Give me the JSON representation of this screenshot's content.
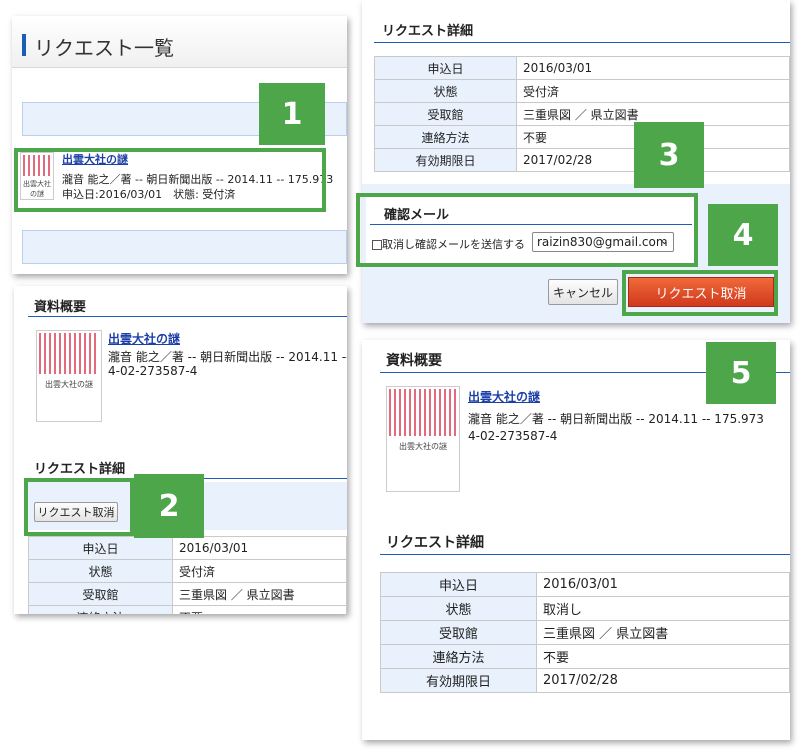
{
  "badges": [
    "1",
    "2",
    "3",
    "4",
    "5"
  ],
  "panel1": {
    "title": "リクエスト一覧",
    "item": {
      "book_title": "出雲大社の謎",
      "info": "瀧音 能之／著 -- 朝日新聞出版 -- 2014.11 -- 175.973",
      "status_line": "申込日:2016/03/01　状態: 受付済"
    },
    "thumb_title": "出雲大社の謎"
  },
  "panel2": {
    "overview_title": "資料概要",
    "book_title": "出雲大社の謎",
    "info_line1": "瀧音 能之／著 -- 朝日新聞出版 -- 2014.11 --",
    "info_line2": "4-02-273587-4",
    "thumb_title": "出雲大社の謎",
    "detail_title": "リクエスト詳細",
    "cancel_button": "リクエスト取消",
    "rows": [
      {
        "k": "申込日",
        "v": "2016/03/01"
      },
      {
        "k": "状態",
        "v": "受付済"
      },
      {
        "k": "受取館",
        "v": "三重県図 ／ 県立図書"
      },
      {
        "k": "連絡方法",
        "v": "不要"
      }
    ]
  },
  "panel3": {
    "detail_title": "リクエスト詳細",
    "rows": [
      {
        "k": "申込日",
        "v": "2016/03/01"
      },
      {
        "k": "状態",
        "v": "受付済"
      },
      {
        "k": "受取館",
        "v": "三重県図 ／ 県立図書"
      },
      {
        "k": "連絡方法",
        "v": "不要"
      },
      {
        "k": "有効期限日",
        "v": "2017/02/28"
      }
    ],
    "confirm_title": "確認メール",
    "confirm_label": "取消し確認メールを送信する",
    "email_value": "raizin830@gmail.com",
    "cancel_button": "キャンセル",
    "request_cancel_button": "リクエスト取消"
  },
  "panel4": {
    "overview_title": "資料概要",
    "book_title": "出雲大社の謎",
    "info_line1": "瀧音 能之／著 -- 朝日新聞出版 -- 2014.11 -- 175.973",
    "info_line2": "4-02-273587-4",
    "thumb_title": "出雲大社の謎",
    "detail_title": "リクエスト詳細",
    "rows": [
      {
        "k": "申込日",
        "v": "2016/03/01"
      },
      {
        "k": "状態",
        "v": "取消し"
      },
      {
        "k": "受取館",
        "v": "三重県図 ／ 県立図書"
      },
      {
        "k": "連絡方法",
        "v": "不要"
      },
      {
        "k": "有効期限日",
        "v": "2017/02/28"
      }
    ]
  },
  "colors": {
    "badge_green": "#4ea64b",
    "accent_blue": "#1c5db8",
    "table_header_bg": "#e8f1fc",
    "danger_button": "#d0391c"
  }
}
